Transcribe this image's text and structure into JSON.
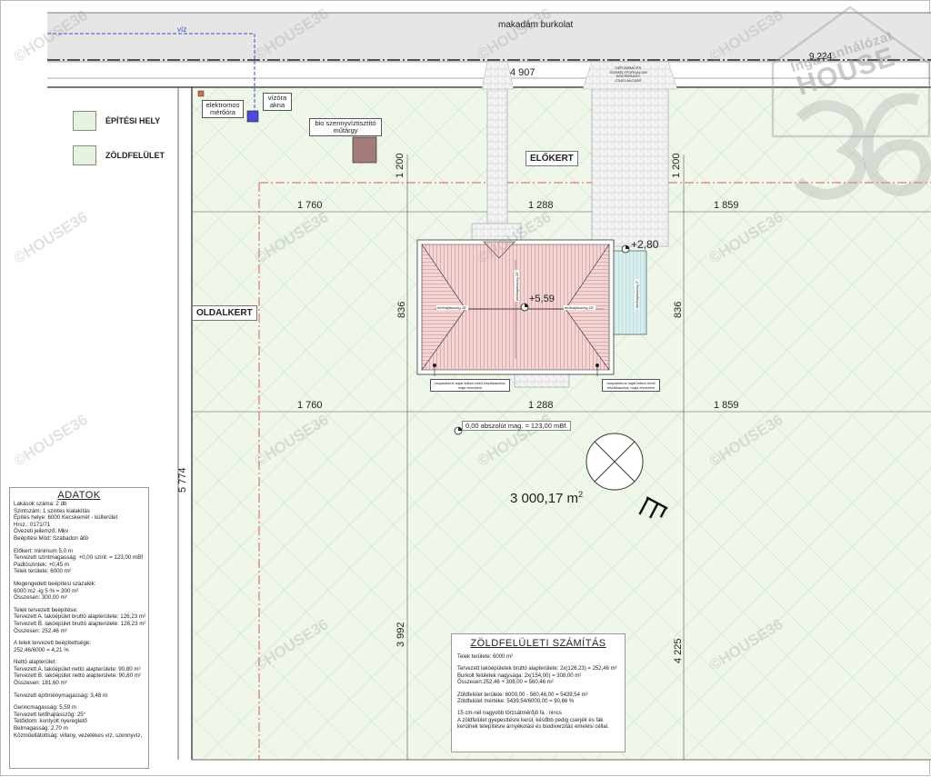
{
  "road": {
    "label": "makadám burkolat"
  },
  "dimensions": {
    "road_width": "4 907",
    "road_right": "9 224",
    "front_left": "1 200",
    "front_right": "1 200",
    "top_left": "1 760",
    "top_mid": "1 288",
    "top_right": "1 859",
    "house_depth_left": "836",
    "house_depth_right": "836",
    "bot_left": "1 760",
    "bot_mid": "1 288",
    "bot_right": "1 859",
    "plot_length": "5 774",
    "rear_left": "3 992",
    "rear_right": "4 225"
  },
  "labels": {
    "viz": "víz",
    "elektromos": "elektromos mérőóra",
    "vizora": "vízóra akna",
    "bio": "bio szennyvíztisztító műtárgy",
    "gepjarmu": "GÉPJÁRMŰ ÉS SZEMÉLYFORGALOM KÖZTERÜLET CSATLAKOZÁS",
    "elokert": "ELŐKERT",
    "oldalkert": "OLDALKERT",
    "level_280": "+2,80",
    "level_559": "+5,59",
    "abs_level": "0,00 abszolút mag. = 123,00 mBf.",
    "area": "3 000,17 m",
    "area_sup": "2",
    "roof_note_l": "csapadékvíz saját telken belül elszikkasztva, majd elvezetve",
    "roof_note_r": "csapadékvíz saját telken belül elszikkasztva, majd elvezetve",
    "slope_l": "tetőhajlásszög 25°",
    "slope_r": "tetőhajlásszög 25°",
    "slope_c": "tetőhajlásszög 25°",
    "slope_terrace": "tetőhajlásszög 2°"
  },
  "legend": [
    {
      "label": "ÉPÍTÉSI HELY"
    },
    {
      "label": "ZÖLDFELÜLET"
    }
  ],
  "watermark": {
    "brand_line1": "Ingatlanhálózat",
    "brand_line2": "HOUSE",
    "brand_num": "36",
    "small": "©HOUSE36"
  },
  "adatok": {
    "title": "ADATOK",
    "lines": [
      "Lakások száma: 2 db",
      "Szintszám: 1 szintes kialakítás",
      "Építés helye: 6000 Kecskemét - külterület",
      "Hrsz.: 0171/71",
      "Övezeti jellemző: Mkv",
      "Beépítési Mód: Szabadon álló",
      "",
      "Előkert: minimum 5,0 m",
      "Tervezett szintmagasság: +0,00 szint: = 123,00 mBf",
      "Padlószintek: +0,45 m",
      "Telek területe: 6000 m²",
      "",
      "Megengedett beépítési százalék:",
      "6000 m2 -ig 5 % = 300 m²",
      "Összesen: 300,00 m²",
      "",
      "Telek tervezett beépítése:",
      "Tervezett A. lakóépület bruttó alapterülete: 126,23 m²",
      "Tervezett B. lakóépület bruttó alapterülete: 126,23 m²",
      "Összesen: 252,46 m²",
      "",
      "A telek tervezett beépítettsége:",
      "252,46/6000 = 4,21 %",
      "",
      "Nettó alapterület:",
      "Tervezett A. lakóépület nettó alapterülete: 90,80 m²",
      "Tervezett B. lakóépület nettó alapterülete: 90,80 m²",
      "Összesen: 181,60 m²",
      "",
      "Tervezett építménymagasság: 3,48 m",
      "",
      "Gerincmagasság: 5,59 m",
      "Tervezett tetőhajlásszög: 25°",
      "Tetőidom: kontyolt nyeregtető",
      "Belmagasság: 2,70 m",
      "Közműellátottság: villany, vezetékes víz, szennyvíz,"
    ]
  },
  "zold": {
    "title": "ZÖLDFELÜLETI SZÁMÍTÁS",
    "lines": [
      "Telek területe: 6000 m²",
      "",
      "Tervezett lakóépületek bruttó alapterülete: 2x(126,23) = 252,46 m²",
      "Burkolt felületek nagysága: 2x(154,00) = 308,00 m²",
      "Összesen:252,46 + 308,00 = 560,46 m²",
      "",
      "Zöldfelület területe: 6000,00 - 560,46,00 = 5439,54 m²",
      "Zöldfelület mértéke: 5439,54/6000,00 = 90,66 %",
      "",
      "15 cm-nél nagyobb törzsátmérőjű fa : nincs",
      "A zöldfelület gyepesítésre kerül, később pedig cserjék és fák",
      "kerülnek telepítésre árnyékolási és biodiverzitás emelési céllal."
    ]
  }
}
